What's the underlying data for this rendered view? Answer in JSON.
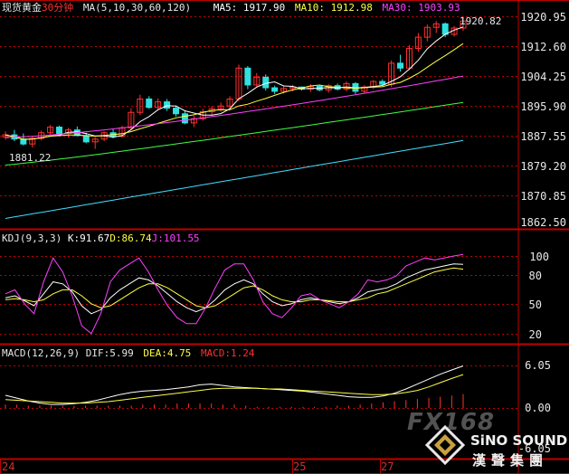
{
  "header": {
    "instrument": "现货黄金",
    "period": "30分钟",
    "ma_label": "MA(5,10,30,60,120)",
    "ma5": "MA5: 1917.90",
    "ma10": "MA10: 1912.98",
    "ma30": "MA30: 1903.93"
  },
  "kdj_header": {
    "params": "KDJ(9,3,3)",
    "k": "K:91.67",
    "d": "D:86.74",
    "j": "J:101.55"
  },
  "macd_header": {
    "params": "MACD(12,26,9)",
    "dif": "DIF:5.99",
    "dea": "DEA:4.75",
    "macd": "MACD:1.24"
  },
  "annotations": {
    "high": "1920.82",
    "low": "1881.22"
  },
  "price_axis": [
    "1920.95",
    "1912.60",
    "1904.25",
    "1895.90",
    "1887.55",
    "1879.20",
    "1870.85",
    "1862.50"
  ],
  "kdj_axis": [
    "100",
    "80",
    "50",
    "20"
  ],
  "macd_axis": [
    "6.05",
    "0.00",
    "-6.05"
  ],
  "dates": [
    "24",
    "25",
    "27"
  ],
  "watermark": {
    "fx": "FX168",
    "brand": "SiNO SOUND",
    "brand_cn": "漢聲集團"
  },
  "colors": {
    "up": "#ff3030",
    "down": "#30e0e0",
    "ma5": "#ffffff",
    "ma10": "#ffff40",
    "ma30": "#ff40ff",
    "ma60": "#40ff40",
    "ma120": "#40e0ff",
    "grid": "#c00000"
  },
  "chart_data": [
    {
      "type": "candlestick",
      "title": "现货黄金 30分钟",
      "ylim": [
        1862.5,
        1920.95
      ],
      "candles": [
        [
          1886.6,
          1888.2,
          1885.8,
          1887.2
        ],
        [
          1887.2,
          1888.6,
          1885.4,
          1886.0
        ],
        [
          1886.0,
          1887.6,
          1884.2,
          1884.6
        ],
        [
          1884.6,
          1886.8,
          1883.6,
          1886.2
        ],
        [
          1886.2,
          1888.4,
          1885.6,
          1887.8
        ],
        [
          1887.8,
          1890.0,
          1887.0,
          1889.4
        ],
        [
          1889.4,
          1889.8,
          1887.2,
          1887.6
        ],
        [
          1887.6,
          1889.2,
          1886.4,
          1888.6
        ],
        [
          1888.6,
          1889.6,
          1886.8,
          1887.0
        ],
        [
          1887.0,
          1887.8,
          1884.8,
          1885.2
        ],
        [
          1885.2,
          1886.6,
          1883.2,
          1886.0
        ],
        [
          1886.0,
          1888.2,
          1885.4,
          1887.8
        ],
        [
          1887.8,
          1888.8,
          1886.2,
          1886.8
        ],
        [
          1886.8,
          1889.8,
          1886.4,
          1889.2
        ],
        [
          1889.2,
          1894.8,
          1888.8,
          1893.6
        ],
        [
          1893.6,
          1898.6,
          1892.8,
          1897.4
        ],
        [
          1897.4,
          1898.2,
          1894.6,
          1895.0
        ],
        [
          1895.0,
          1897.6,
          1894.2,
          1896.6
        ],
        [
          1896.6,
          1897.4,
          1894.0,
          1894.8
        ],
        [
          1894.8,
          1895.6,
          1892.4,
          1893.2
        ],
        [
          1893.2,
          1894.0,
          1890.2,
          1890.6
        ],
        [
          1890.6,
          1892.6,
          1889.4,
          1891.8
        ],
        [
          1891.8,
          1894.6,
          1891.2,
          1893.8
        ],
        [
          1893.8,
          1895.4,
          1892.6,
          1894.6
        ],
        [
          1894.6,
          1896.4,
          1893.8,
          1895.4
        ],
        [
          1895.4,
          1898.2,
          1894.6,
          1897.4
        ],
        [
          1897.4,
          1907.2,
          1896.8,
          1906.2
        ],
        [
          1906.2,
          1906.8,
          1900.2,
          1901.4
        ],
        [
          1901.4,
          1904.8,
          1900.8,
          1903.6
        ],
        [
          1903.6,
          1904.4,
          1899.8,
          1900.6
        ],
        [
          1900.6,
          1901.2,
          1898.8,
          1899.6
        ],
        [
          1899.6,
          1901.0,
          1899.0,
          1900.4
        ],
        [
          1900.4,
          1901.4,
          1899.6,
          1900.8
        ],
        [
          1900.8,
          1901.0,
          1899.8,
          1900.2
        ],
        [
          1900.2,
          1901.6,
          1899.4,
          1901.0
        ],
        [
          1901.0,
          1901.4,
          1899.6,
          1900.0
        ],
        [
          1900.0,
          1901.6,
          1899.2,
          1901.2
        ],
        [
          1901.2,
          1901.8,
          1899.8,
          1900.2
        ],
        [
          1900.2,
          1902.4,
          1899.6,
          1901.8
        ],
        [
          1901.8,
          1902.2,
          1898.8,
          1899.6
        ],
        [
          1899.6,
          1901.4,
          1899.0,
          1900.8
        ],
        [
          1900.8,
          1902.8,
          1900.2,
          1902.4
        ],
        [
          1902.4,
          1903.0,
          1901.2,
          1901.6
        ],
        [
          1901.6,
          1908.4,
          1900.8,
          1907.6
        ],
        [
          1907.6,
          1910.0,
          1905.2,
          1906.2
        ],
        [
          1906.2,
          1912.8,
          1905.6,
          1911.8
        ],
        [
          1911.8,
          1916.2,
          1910.8,
          1915.0
        ],
        [
          1915.0,
          1918.6,
          1913.8,
          1917.8
        ],
        [
          1917.8,
          1919.6,
          1916.2,
          1918.8
        ],
        [
          1918.8,
          1919.2,
          1915.0,
          1915.8
        ],
        [
          1915.8,
          1918.2,
          1915.2,
          1917.6
        ],
        [
          1917.6,
          1920.82,
          1916.8,
          1919.6
        ]
      ]
    },
    {
      "type": "line",
      "title": "KDJ(9,3,3)",
      "ylim": [
        20,
        105
      ],
      "series": [
        {
          "name": "K",
          "values": [
            58,
            60,
            55,
            50,
            62,
            74,
            72,
            64,
            50,
            42,
            46,
            58,
            66,
            72,
            78,
            76,
            70,
            62,
            54,
            48,
            44,
            48,
            56,
            66,
            72,
            76,
            72,
            62,
            54,
            50,
            52,
            56,
            58,
            56,
            54,
            52,
            54,
            58,
            64,
            66,
            68,
            72,
            78,
            82,
            86,
            88,
            90,
            92,
            91.67
          ]
        },
        {
          "name": "D",
          "values": [
            56,
            57,
            56,
            54,
            56,
            62,
            66,
            66,
            60,
            52,
            48,
            50,
            56,
            62,
            68,
            72,
            72,
            68,
            62,
            56,
            50,
            48,
            50,
            56,
            62,
            68,
            70,
            66,
            60,
            56,
            54,
            54,
            56,
            56,
            55,
            54,
            54,
            56,
            58,
            62,
            64,
            68,
            72,
            76,
            80,
            84,
            86,
            88,
            86.74
          ]
        },
        {
          "name": "J",
          "values": [
            62,
            66,
            52,
            42,
            74,
            98,
            84,
            60,
            30,
            22,
            42,
            74,
            86,
            92,
            98,
            84,
            66,
            50,
            38,
            32,
            32,
            48,
            68,
            86,
            92,
            92,
            76,
            54,
            42,
            38,
            48,
            60,
            62,
            56,
            52,
            48,
            54,
            62,
            76,
            74,
            76,
            80,
            90,
            94,
            98,
            96,
            98,
            100,
            101.55
          ]
        }
      ]
    },
    {
      "type": "line",
      "title": "MACD(12,26,9)",
      "ylim": [
        -6.05,
        6.05
      ],
      "series": [
        {
          "name": "DIF",
          "values": [
            1.8,
            1.4,
            1.0,
            0.7,
            0.5,
            0.5,
            0.6,
            0.8,
            1.1,
            1.5,
            1.9,
            2.2,
            2.4,
            2.5,
            2.6,
            2.8,
            3.0,
            3.3,
            3.4,
            3.2,
            3.0,
            2.9,
            2.8,
            2.7,
            2.6,
            2.5,
            2.4,
            2.2,
            2.0,
            1.8,
            1.6,
            1.5,
            1.5,
            1.7,
            2.1,
            2.7,
            3.4,
            4.1,
            4.8,
            5.4,
            5.99
          ]
        },
        {
          "name": "DEA",
          "values": [
            1.2,
            1.1,
            1.0,
            0.9,
            0.8,
            0.7,
            0.7,
            0.7,
            0.8,
            0.9,
            1.1,
            1.3,
            1.5,
            1.7,
            1.9,
            2.1,
            2.3,
            2.5,
            2.7,
            2.8,
            2.8,
            2.8,
            2.8,
            2.7,
            2.7,
            2.6,
            2.5,
            2.4,
            2.3,
            2.2,
            2.1,
            2.0,
            1.9,
            1.9,
            2.0,
            2.2,
            2.5,
            3.0,
            3.6,
            4.2,
            4.75
          ]
        },
        {
          "name": "MACD",
          "values": [
            0.3,
            0.3,
            0.2,
            0.2,
            0.2,
            0.2,
            0.2,
            0.2,
            0.2,
            0.2,
            0.2,
            0.2,
            0.3,
            0.3,
            0.3,
            0.4,
            0.4,
            0.4,
            0.4,
            0.3,
            0.3,
            0.2,
            0.1,
            0.1,
            0.1,
            0.1,
            0.1,
            0.1,
            0.1,
            0.2,
            0.2,
            0.3,
            0.4,
            0.5,
            0.6,
            0.7,
            0.8,
            0.9,
            1.0,
            1.1,
            1.24
          ]
        }
      ]
    }
  ]
}
